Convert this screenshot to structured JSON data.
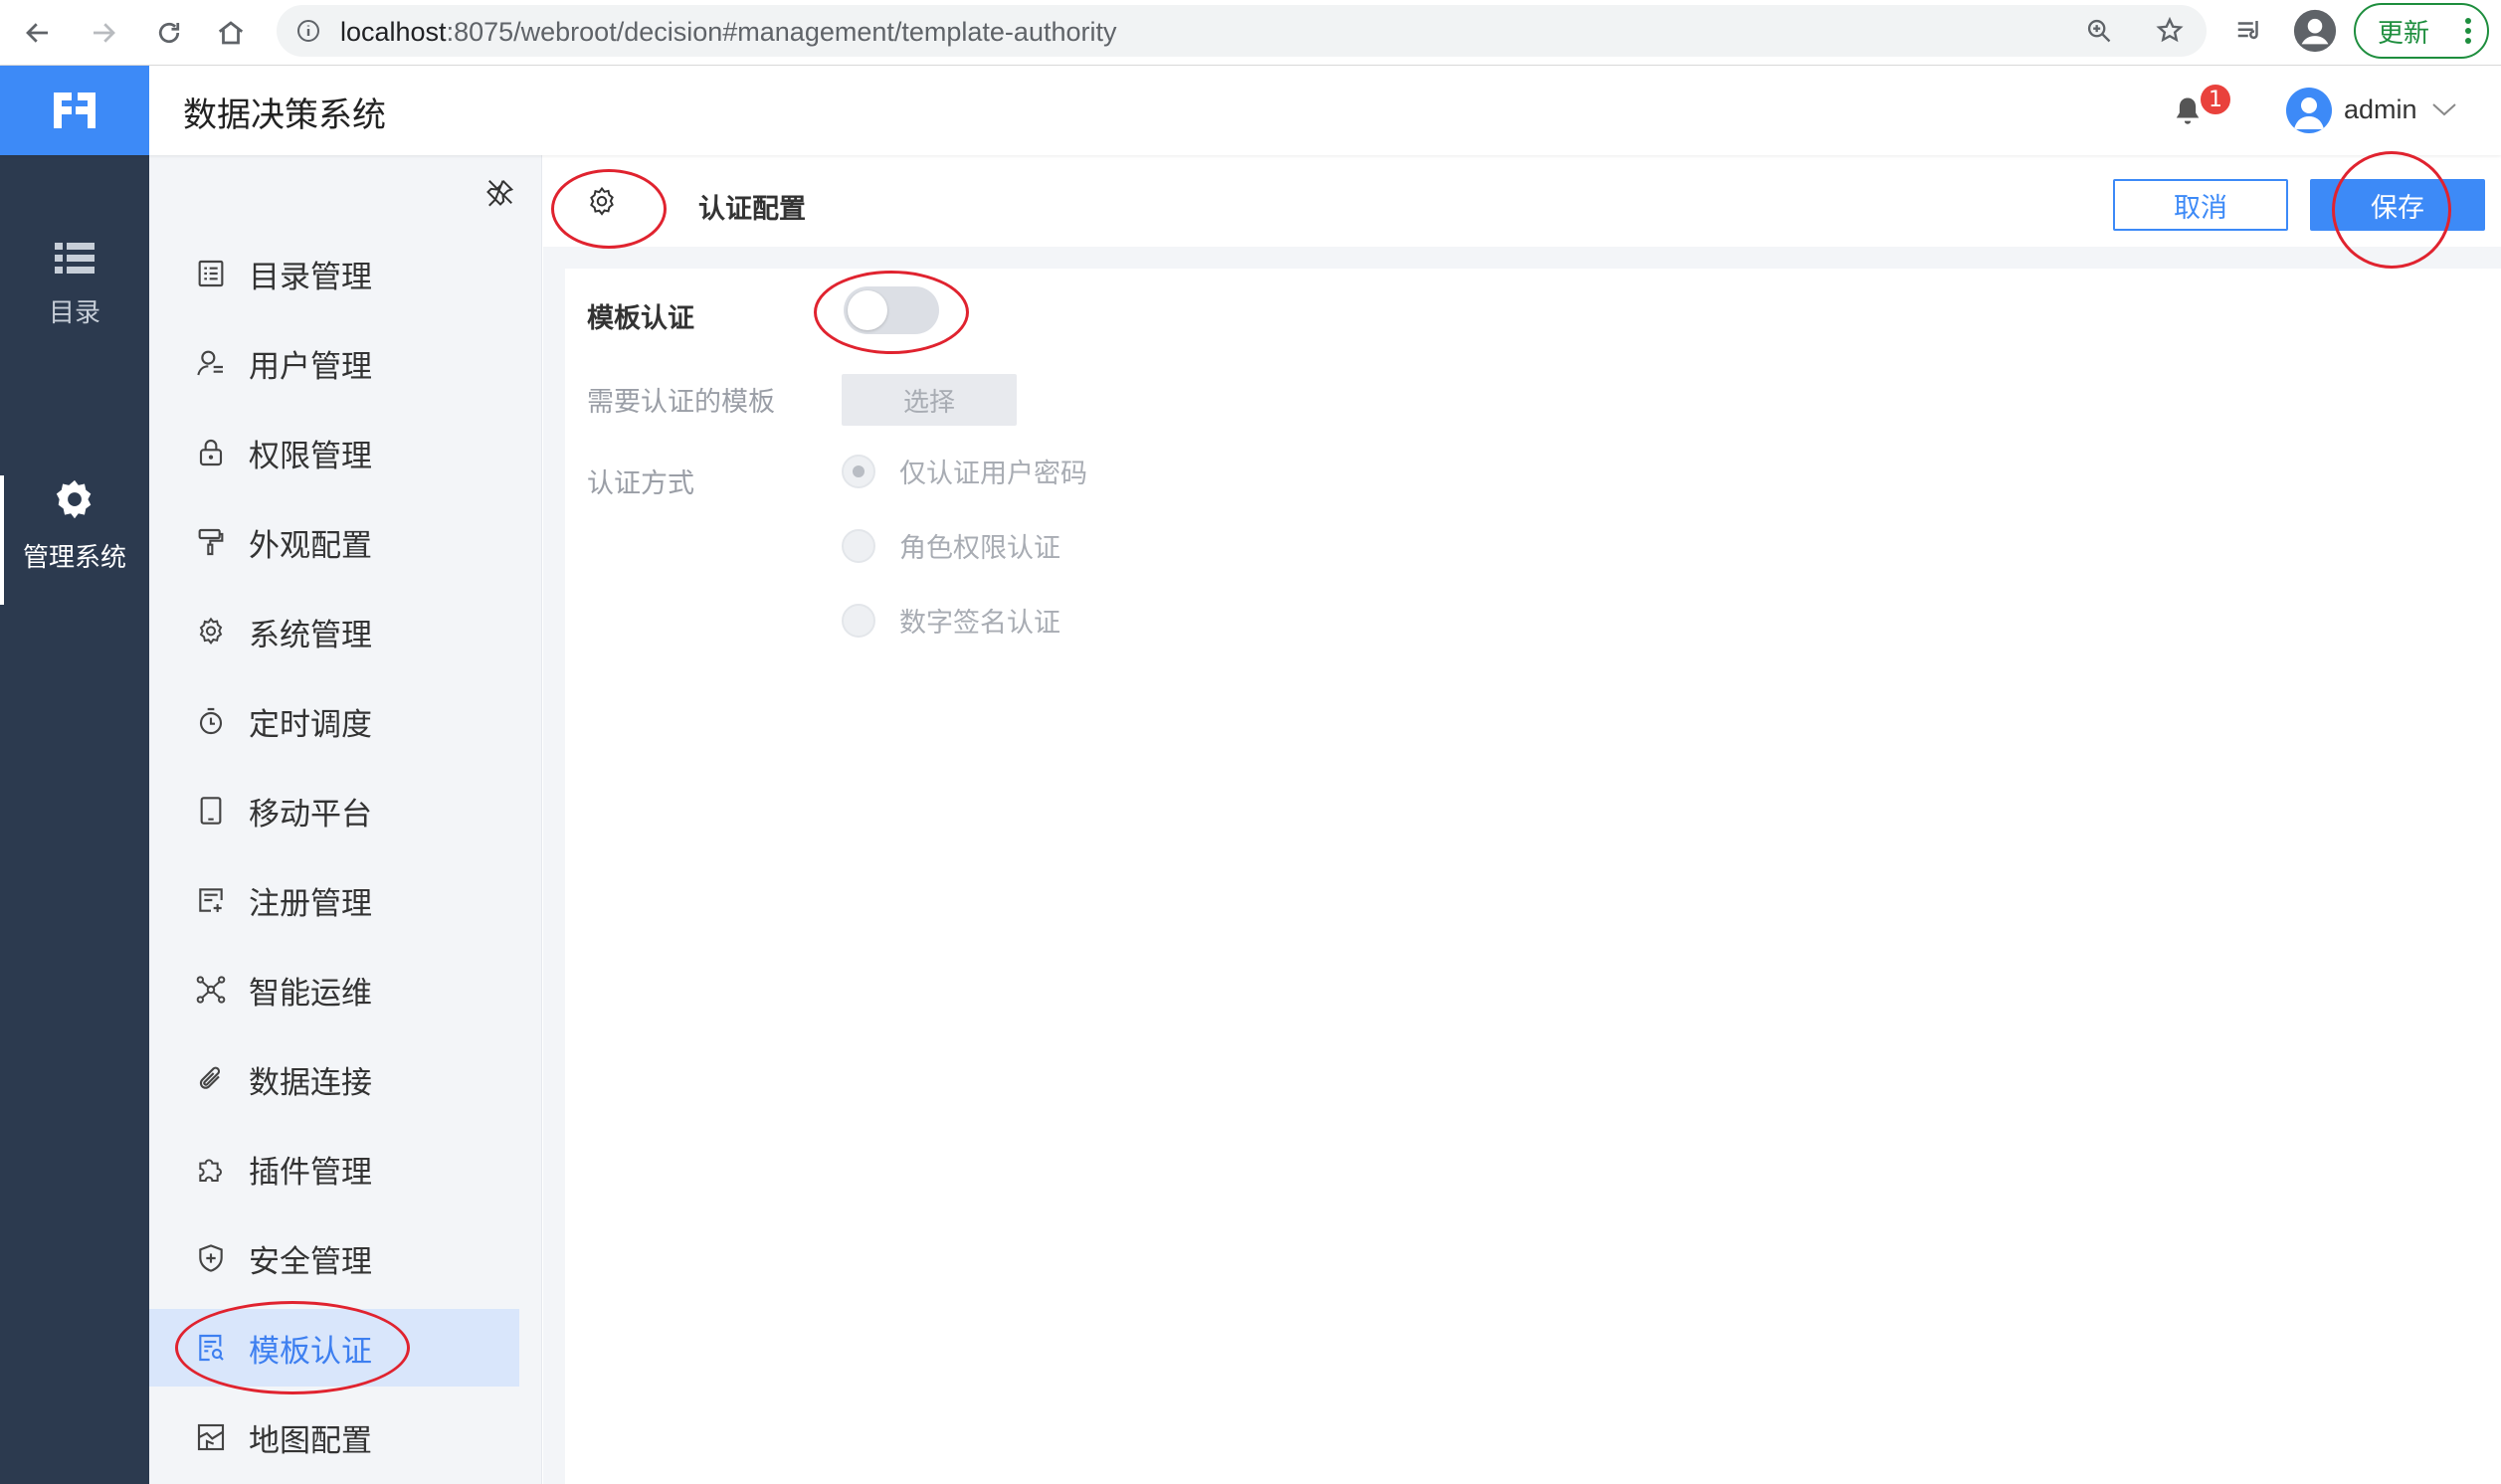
{
  "browser": {
    "url_host": "localhost",
    "url_rest": ":8075/webroot/decision#management/template-authority",
    "update_label": "更新"
  },
  "header": {
    "title": "数据决策系统",
    "notification_count": "1",
    "user": "admin"
  },
  "rail": {
    "items": [
      {
        "label": "目录",
        "icon": "list-icon"
      },
      {
        "label": "管理系统",
        "icon": "gear-icon",
        "active": true
      }
    ]
  },
  "sidebar": {
    "items": [
      {
        "label": "目录管理",
        "icon": "catalog-icon"
      },
      {
        "label": "用户管理",
        "icon": "user-icon"
      },
      {
        "label": "权限管理",
        "icon": "lock-icon"
      },
      {
        "label": "外观配置",
        "icon": "paint-roller-icon"
      },
      {
        "label": "系统管理",
        "icon": "gear-icon"
      },
      {
        "label": "定时调度",
        "icon": "timer-icon"
      },
      {
        "label": "移动平台",
        "icon": "tablet-icon"
      },
      {
        "label": "注册管理",
        "icon": "register-icon"
      },
      {
        "label": "智能运维",
        "icon": "network-icon"
      },
      {
        "label": "数据连接",
        "icon": "paperclip-icon"
      },
      {
        "label": "插件管理",
        "icon": "puzzle-icon"
      },
      {
        "label": "安全管理",
        "icon": "shield-icon"
      },
      {
        "label": "模板认证",
        "icon": "template-auth-icon",
        "active": true
      },
      {
        "label": "地图配置",
        "icon": "map-icon"
      }
    ]
  },
  "toolbar": {
    "title": "认证配置",
    "cancel_label": "取消",
    "save_label": "保存"
  },
  "form": {
    "toggle_label": "模板认证",
    "toggle_on": false,
    "templates_label": "需要认证的模板",
    "select_label": "选择",
    "method_label": "认证方式",
    "methods": [
      {
        "label": "仅认证用户密码",
        "checked": true
      },
      {
        "label": "角色权限认证",
        "checked": false
      },
      {
        "label": "数字签名认证",
        "checked": false
      }
    ]
  },
  "colors": {
    "accent": "#3d8af7",
    "rail_bg": "#2c3a4f",
    "annotation": "#e0232f"
  }
}
